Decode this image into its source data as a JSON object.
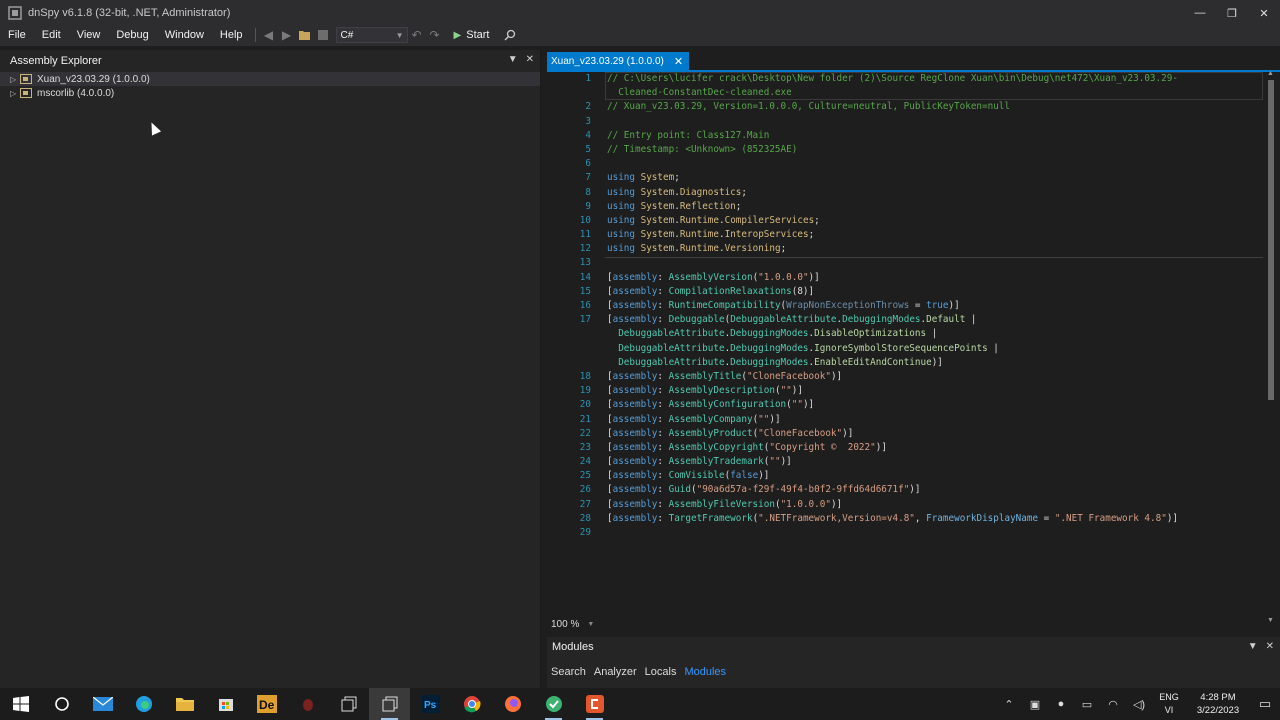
{
  "window": {
    "title": "dnSpy v6.1.8 (32-bit, .NET, Administrator)",
    "minimize": "—",
    "restore": "❐",
    "close": "✕"
  },
  "menu": {
    "items": [
      "File",
      "Edit",
      "View",
      "Debug",
      "Window",
      "Help"
    ],
    "language": "C#",
    "start_label": "Start"
  },
  "explorer": {
    "title": "Assembly Explorer",
    "items": [
      {
        "label": "Xuan_v23.03.29 (1.0.0.0)"
      },
      {
        "label": "mscorlib (4.0.0.0)"
      }
    ]
  },
  "editor": {
    "tab_label": "Xuan_v23.03.29 (1.0.0.0)",
    "zoom": "100 %",
    "lines": [
      {
        "n": "1",
        "html": "<span class='c'>// C:\\Users\\lucifer crack\\Desktop\\New folder (2)\\Source RegClone Xuan\\bin\\Debug\\net472\\Xuan_v23.03.29-</span>"
      },
      {
        "n": "",
        "html": "<span class='c'>  Cleaned-ConstantDec-cleaned.exe</span>"
      },
      {
        "n": "2",
        "html": "<span class='c'>// Xuan_v23.03.29, Version=1.0.0.0, Culture=neutral, PublicKeyToken=null</span>"
      },
      {
        "n": "3",
        "html": ""
      },
      {
        "n": "4",
        "html": "<span class='c'>// Entry point: Class127.Main</span>"
      },
      {
        "n": "5",
        "html": "<span class='c'>// Timestamp: &lt;Unknown&gt; (852325AE)</span>"
      },
      {
        "n": "6",
        "html": ""
      },
      {
        "n": "7",
        "html": "<span class='k'>using</span> <span class='ns'>System</span>;"
      },
      {
        "n": "8",
        "html": "<span class='k'>using</span> <span class='ns'>System</span>.<span class='ns'>Diagnostics</span>;"
      },
      {
        "n": "9",
        "html": "<span class='k'>using</span> <span class='ns'>System</span>.<span class='ns'>Reflection</span>;"
      },
      {
        "n": "10",
        "html": "<span class='k'>using</span> <span class='ns'>System</span>.<span class='ns'>Runtime</span>.<span class='ns'>CompilerServices</span>;"
      },
      {
        "n": "11",
        "html": "<span class='k'>using</span> <span class='ns'>System</span>.<span class='ns'>Runtime</span>.<span class='ns'>InteropServices</span>;"
      },
      {
        "n": "12",
        "html": "<span class='k'>using</span> <span class='ns'>System</span>.<span class='ns'>Runtime</span>.<span class='ns'>Versioning</span>;"
      },
      {
        "n": "13",
        "html": ""
      },
      {
        "n": "14",
        "html": "[<span class='k'>assembly</span>: <span class='t'>AssemblyVersion</span>(<span class='s'>\"1.0.0.0\"</span>)]"
      },
      {
        "n": "15",
        "html": "[<span class='k'>assembly</span>: <span class='t'>CompilationRelaxations</span>(8)]"
      },
      {
        "n": "16",
        "html": "[<span class='k'>assembly</span>: <span class='t'>RuntimeCompatibility</span>(<span class='p'>WrapNonExceptionThrows</span> = <span class='k'>true</span>)]"
      },
      {
        "n": "17",
        "html": "[<span class='k'>assembly</span>: <span class='t'>Debuggable</span>(<span class='t'>DebuggableAttribute</span>.<span class='t'>DebuggingModes</span>.<span class='e'>Default</span> |"
      },
      {
        "n": "",
        "html": "  <span class='t'>DebuggableAttribute</span>.<span class='t'>DebuggingModes</span>.<span class='e'>DisableOptimizations</span> |"
      },
      {
        "n": "",
        "html": "  <span class='t'>DebuggableAttribute</span>.<span class='t'>DebuggingModes</span>.<span class='e'>IgnoreSymbolStoreSequencePoints</span> |"
      },
      {
        "n": "",
        "html": "  <span class='t'>DebuggableAttribute</span>.<span class='t'>DebuggingModes</span>.<span class='e'>EnableEditAndContinue</span>)]"
      },
      {
        "n": "18",
        "html": "[<span class='k'>assembly</span>: <span class='t'>AssemblyTitle</span>(<span class='s'>\"CloneFacebook\"</span>)]"
      },
      {
        "n": "19",
        "html": "[<span class='k'>assembly</span>: <span class='t'>AssemblyDescription</span>(<span class='s'>\"\"</span>)]"
      },
      {
        "n": "20",
        "html": "[<span class='k'>assembly</span>: <span class='t'>AssemblyConfiguration</span>(<span class='s'>\"\"</span>)]"
      },
      {
        "n": "21",
        "html": "[<span class='k'>assembly</span>: <span class='t'>AssemblyCompany</span>(<span class='s'>\"\"</span>)]"
      },
      {
        "n": "22",
        "html": "[<span class='k'>assembly</span>: <span class='t'>AssemblyProduct</span>(<span class='s'>\"CloneFacebook\"</span>)]"
      },
      {
        "n": "23",
        "html": "[<span class='k'>assembly</span>: <span class='t'>AssemblyCopyright</span>(<span class='s'>\"Copyright ©  2022\"</span>)]"
      },
      {
        "n": "24",
        "html": "[<span class='k'>assembly</span>: <span class='t'>AssemblyTrademark</span>(<span class='s'>\"\"</span>)]"
      },
      {
        "n": "25",
        "html": "[<span class='k'>assembly</span>: <span class='t'>ComVisible</span>(<span class='k'>false</span>)]"
      },
      {
        "n": "26",
        "html": "[<span class='k'>assembly</span>: <span class='t'>Guid</span>(<span class='s'>\"90a6d57a-f29f-49f4-b0f2-9ffd64d6671f\"</span>)]"
      },
      {
        "n": "27",
        "html": "[<span class='k'>assembly</span>: <span class='t'>AssemblyFileVersion</span>(<span class='s'>\"1.0.0.0\"</span>)]"
      },
      {
        "n": "28",
        "html": "[<span class='k'>assembly</span>: <span class='t'>TargetFramework</span>(<span class='s'>\".NETFramework,Version=v4.8\"</span>, <span class='p2'>FrameworkDisplayName</span> = <span class='s'>\".NET Framework 4.8\"</span>)]"
      },
      {
        "n": "29",
        "html": ""
      }
    ]
  },
  "modules": {
    "title": "Modules",
    "tabs": [
      "Search",
      "Analyzer",
      "Locals",
      "Modules"
    ],
    "active_tab": "Modules"
  },
  "taskbar": {
    "lang_top": "ENG",
    "lang_bottom": "VI",
    "time": "4:28 PM",
    "date": "3/22/2023"
  },
  "colors": {
    "accent": "#007acc",
    "comment": "#57a64a",
    "keyword": "#569cd6",
    "type": "#4ec9b0",
    "string": "#d69d85",
    "namespace": "#dcdcaa"
  }
}
